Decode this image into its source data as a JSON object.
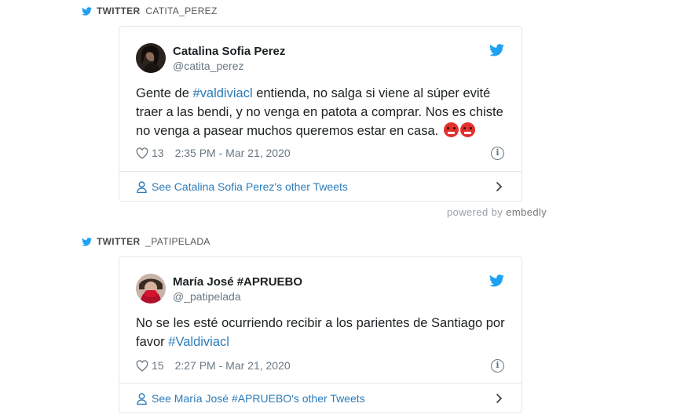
{
  "tweets": [
    {
      "source_prefix": "TWITTER",
      "source_handle": "CATITA_PEREZ",
      "name": "Catalina Sofia Perez",
      "username": "@catita_perez",
      "text_before": "Gente de ",
      "hashtag": "#valdiviacl",
      "text_after": " entienda, no salga si viene al súper evité traer a las bendi, y no venga en patota a comprar. Nos es chiste no venga a pasear muchos queremos estar en casa.",
      "likes": "13",
      "timestamp": "2:35 PM - Mar 21, 2020",
      "other_tweets": "See Catalina Sofia Perez's other Tweets"
    },
    {
      "source_prefix": "TWITTER",
      "source_handle": "_PATIPELADA",
      "name": "María José #APRUEBO",
      "username": "@_patipelada",
      "text_before": "No se les esté ocurriendo recibir a los parientes de Santiago por favor ",
      "hashtag": "#Valdiviacl",
      "text_after": "",
      "likes": "15",
      "timestamp": "2:27 PM - Mar 21, 2020",
      "other_tweets": "See María José #APRUEBO's other Tweets"
    }
  ],
  "embedly": {
    "prefix": "powered by ",
    "brand": "embedly"
  },
  "colors": {
    "link": "#2b7bb9",
    "twitter_blue": "#1da1f2",
    "border": "#e1e8ed",
    "muted": "#697882"
  }
}
